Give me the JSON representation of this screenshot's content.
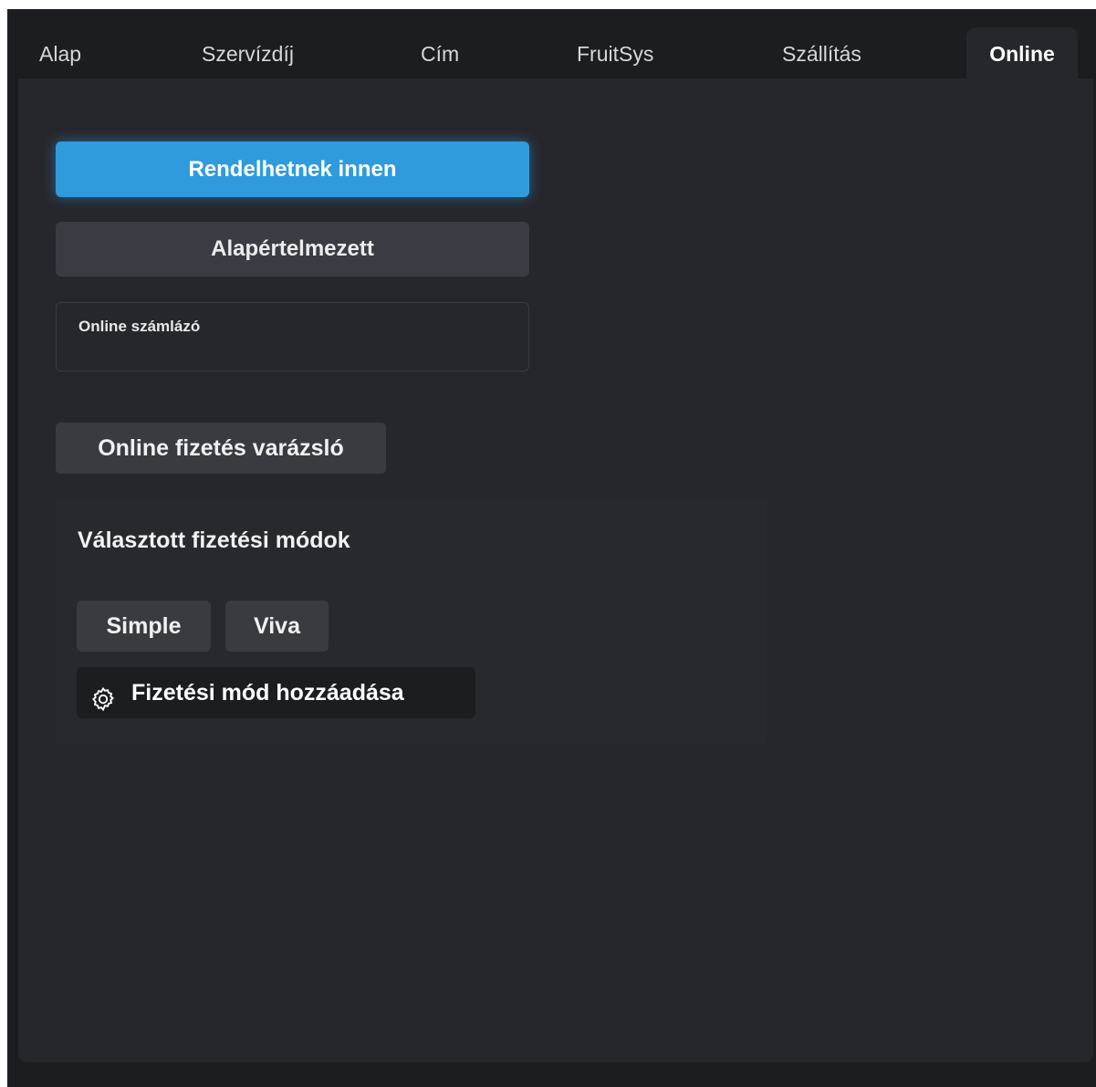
{
  "tabs": [
    {
      "label": "Alap",
      "active": false
    },
    {
      "label": "Szervízdíj",
      "active": false
    },
    {
      "label": "Cím",
      "active": false
    },
    {
      "label": "FruitSys",
      "active": false
    },
    {
      "label": "Szállítás",
      "active": false
    },
    {
      "label": "Online",
      "active": true
    }
  ],
  "buttons": {
    "order_from_here": "Rendelhetnek innen",
    "default": "Alapértelmezett",
    "payment_wizard": "Online fizetés varázsló"
  },
  "invoice_field": {
    "label": "Online számlázó",
    "value": ""
  },
  "payment_methods": {
    "title": "Választott fizetési módok",
    "items": [
      "Simple",
      "Viva"
    ],
    "add_label": "Fizetési mód hozzáadása",
    "add_icon": "gear-icon"
  },
  "colors": {
    "accent": "#2f9bdc",
    "panel": "#26272c",
    "background": "#1c1d20"
  }
}
